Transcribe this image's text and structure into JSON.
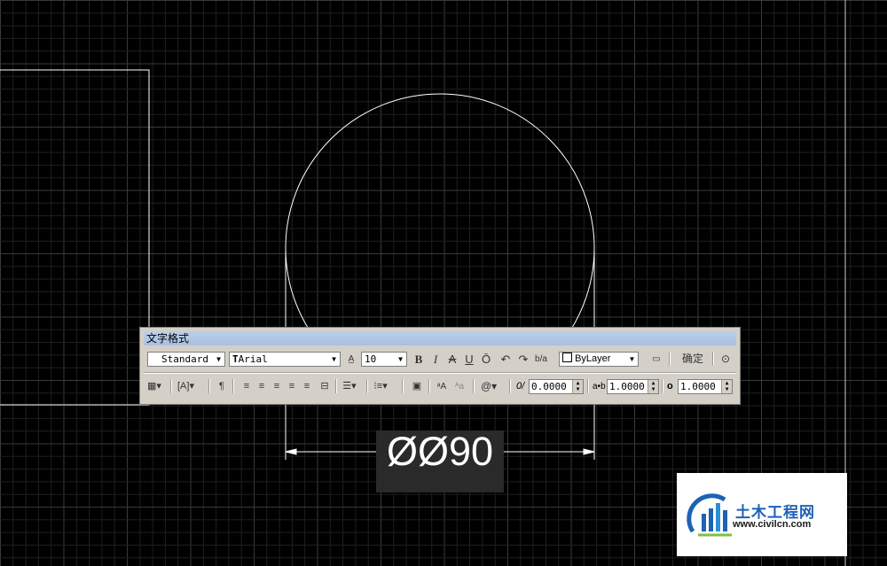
{
  "toolbar": {
    "title": "文字格式",
    "style_value": "Standard",
    "font_value": "Arial",
    "font_prefix_icon": "truetype-icon",
    "height_value": "10",
    "bold_label": "B",
    "italic_label": "I",
    "strike_label": "A",
    "underline_label": "U",
    "overline_label": "Ō",
    "color_value": "ByLayer",
    "ok_label": "确定",
    "oblique_value": "0.0000",
    "tracking_value": "1.0000",
    "width_value": "1.0000",
    "oblique_label": "0/",
    "tracking_label": "a•b",
    "width_label": "o"
  },
  "dimension": {
    "text": "ØØ90"
  },
  "watermark": {
    "name": "土木工程网",
    "url": "www.civilcn.com"
  },
  "colors": {
    "background": "#000000",
    "grid_minor": "#1f1f1f",
    "grid_major": "#3a3a3a",
    "geometry": "#ffffff",
    "toolbar_bg": "#d4d0c8",
    "titlebar": "#a9c0e0",
    "logo_blue": "#1d62b5"
  }
}
